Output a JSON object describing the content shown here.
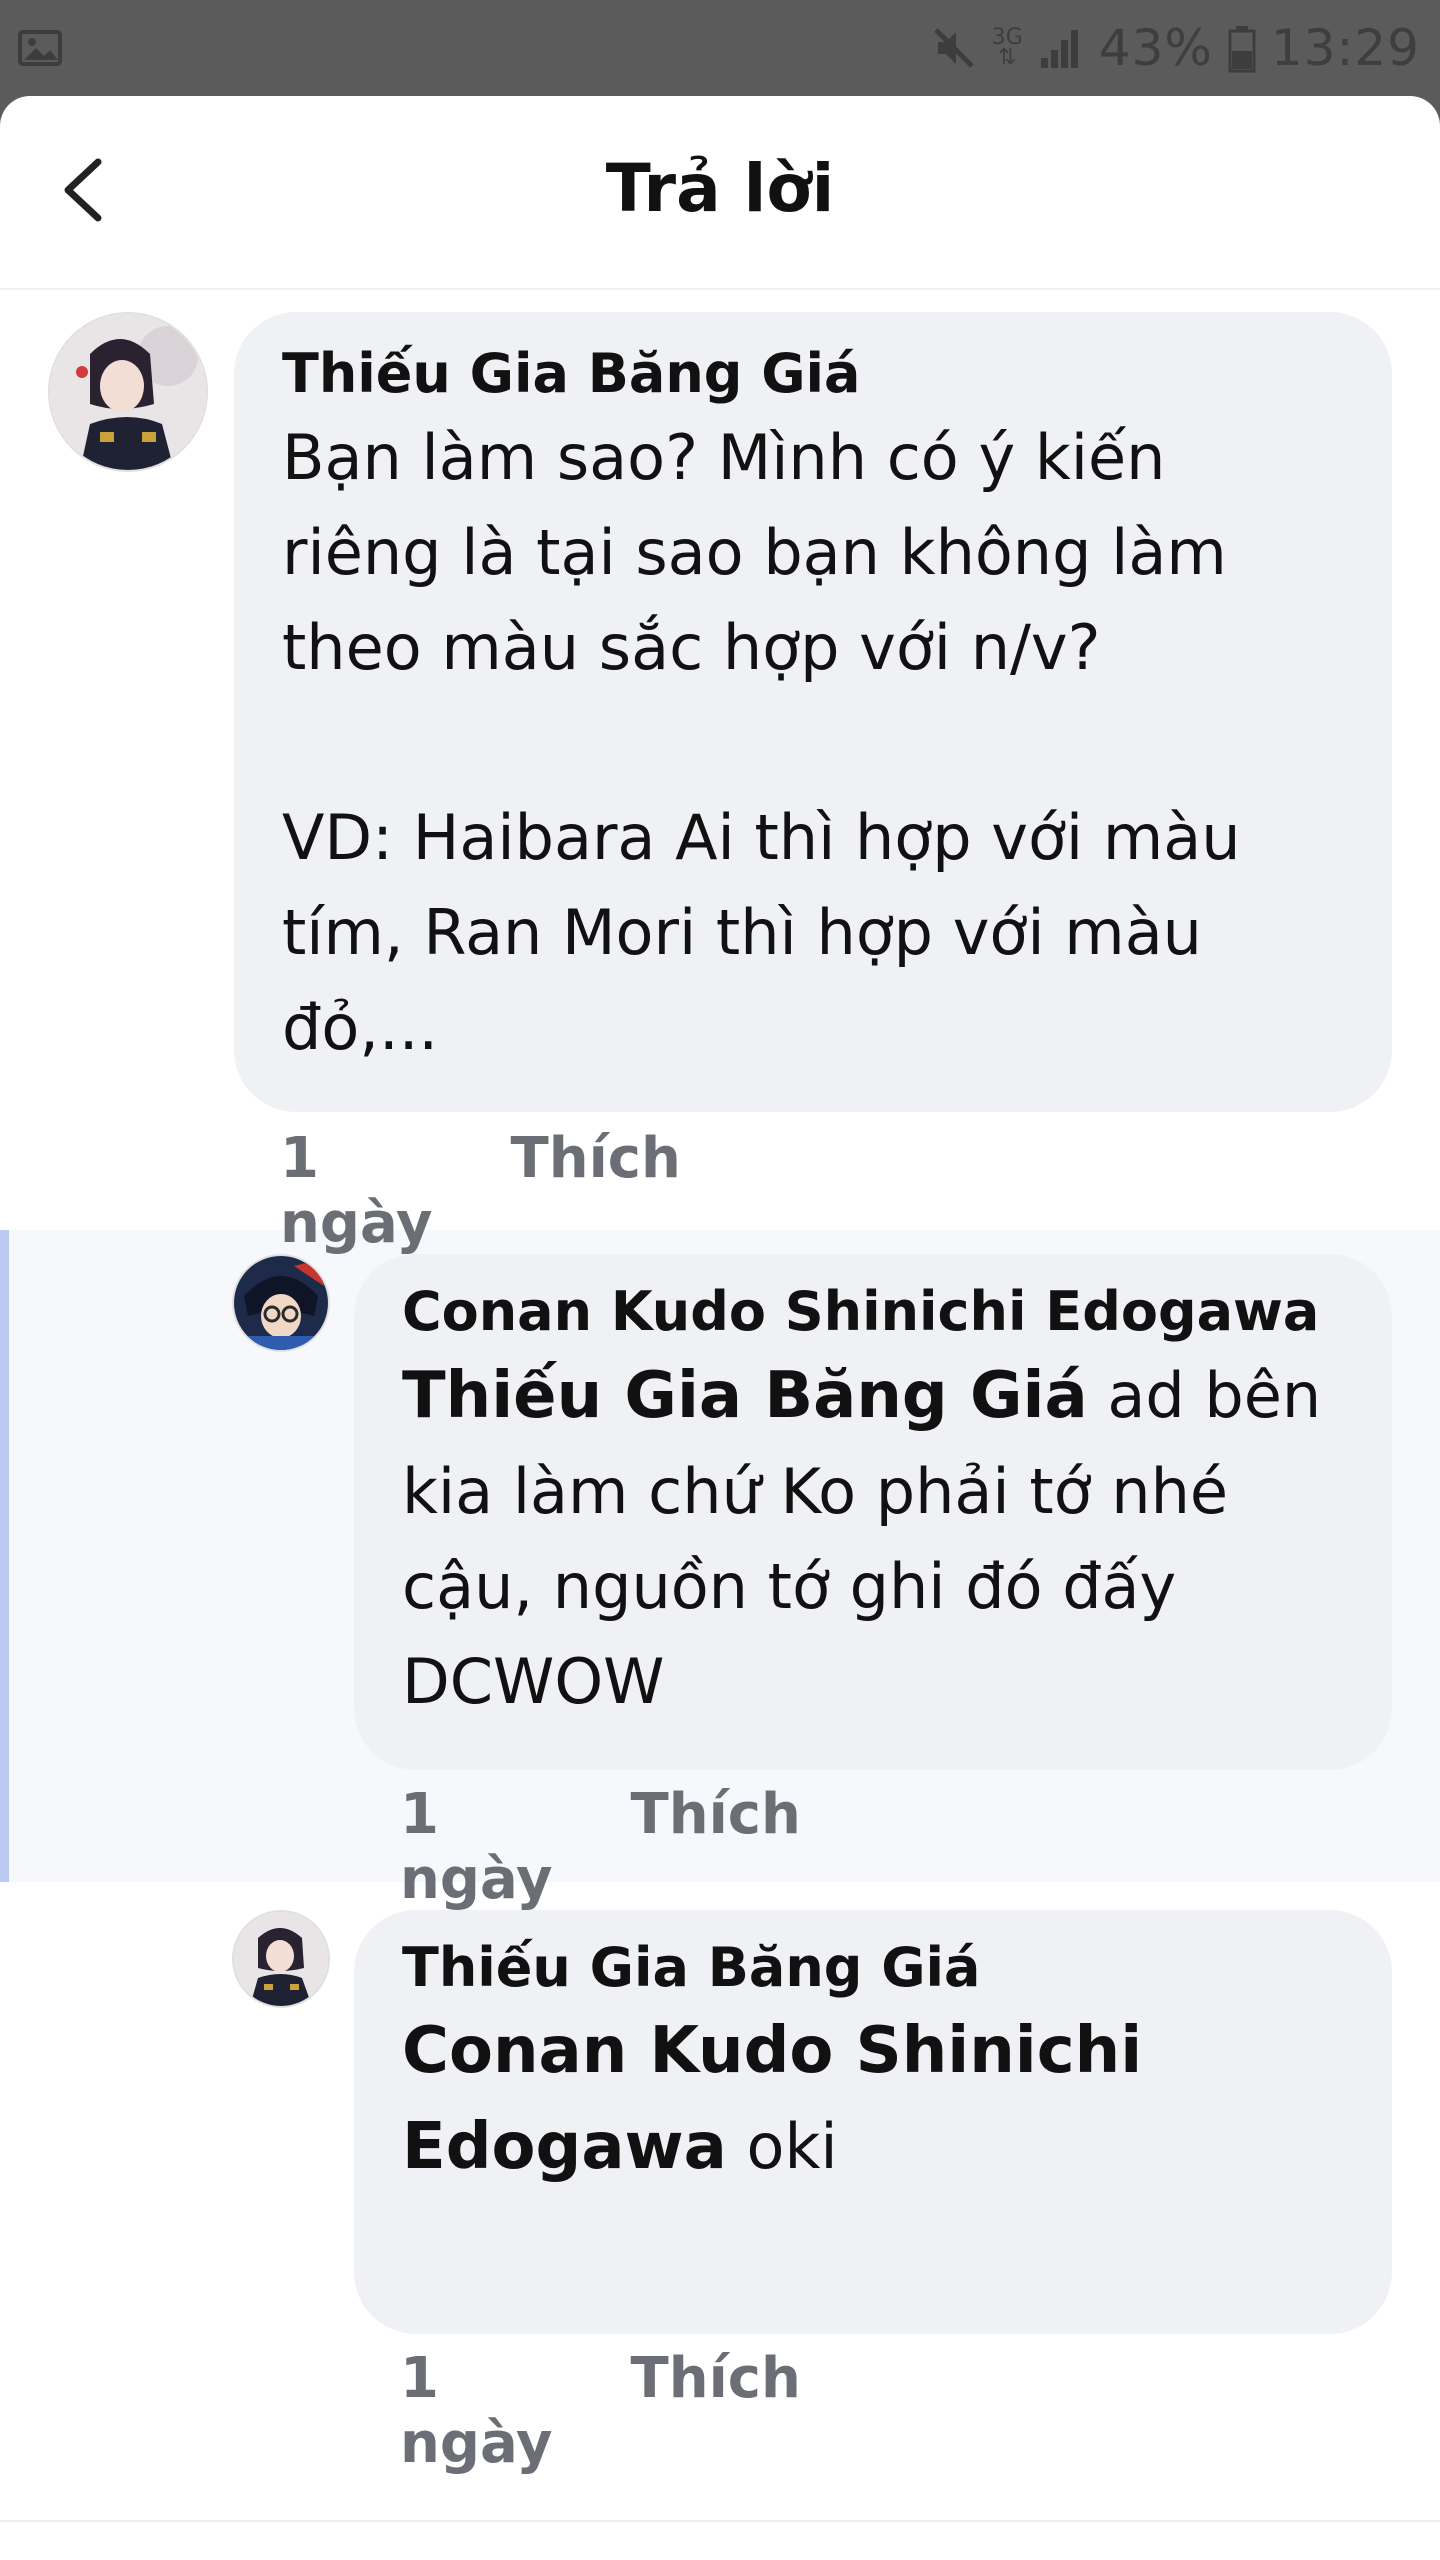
{
  "status_bar": {
    "network_label": "3G",
    "battery_text": "43%",
    "time": "13:29",
    "icons": [
      "image-icon",
      "mute-icon",
      "signal-icon",
      "battery-icon"
    ]
  },
  "header": {
    "title": "Trả lời",
    "back_icon": "chevron-left-icon"
  },
  "comments": [
    {
      "author": "Thiếu Gia Băng Giá",
      "text_lines": [
        "Bạn làm sao? Mình có ý kiến",
        "riêng là tại sao bạn không làm",
        "theo màu sắc hợp với n/v?",
        "",
        "VD: Haibara Ai thì hợp với màu",
        "tím, Ran Mori thì hợp với màu",
        "đỏ,..."
      ],
      "time": "1 ngày",
      "like_label": "Thích"
    },
    {
      "author": "Conan Kudo Shinichi Edogawa",
      "mention": "Thiếu Gia Băng Giá",
      "text_first": "ad bên",
      "text_lines": [
        "kia làm chứ Ko phải tớ nhé",
        "cậu, nguồn tớ ghi đó đấy",
        "DCWOW"
      ],
      "time": "1 ngày",
      "like_label": "Thích"
    },
    {
      "author": "Thiếu Gia Băng Giá",
      "mention_line1": "Conan Kudo Shinichi",
      "mention_line2": "Edogawa",
      "text": "oki",
      "time": "1 ngày",
      "like_label": "Thích"
    }
  ],
  "colors": {
    "bubble": "#f0f1f4",
    "highlight_bg": "#f7f8fb",
    "highlight_bar": "#b9c9ef",
    "meta_text": "#6b6f75"
  }
}
